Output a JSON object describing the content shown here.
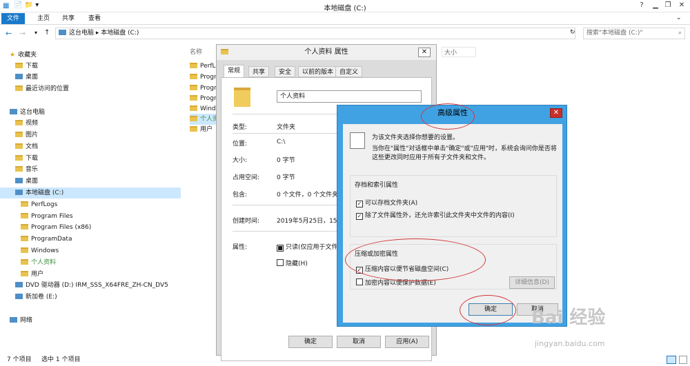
{
  "window": {
    "title": "本地磁盘 (C:)"
  },
  "ribbon": {
    "tabs": [
      "文件",
      "主页",
      "共享",
      "查看"
    ]
  },
  "address": {
    "path": "这台电脑 ▸ 本地磁盘 (C:)",
    "search_placeholder": "搜索\"本地磁盘 (C:)\""
  },
  "nav": {
    "favorites": "收藏夹",
    "fav_items": [
      "下载",
      "桌面",
      "最近访问的位置"
    ],
    "thispc": "这台电脑",
    "pc_items": [
      "视频",
      "图片",
      "文档",
      "下载",
      "音乐",
      "桌面"
    ],
    "drive": "本地磁盘 (C:)",
    "drive_items": [
      "PerfLogs",
      "Program Files",
      "Program Files (x86)",
      "ProgramData",
      "Windows",
      "个人资料",
      "用户"
    ],
    "dvd": "DVD 驱动器 (D:) IRM_SSS_X64FRE_ZH-CN_DV5",
    "newvol": "新加卷 (E:)",
    "network": "网络"
  },
  "main": {
    "col_name": "名称",
    "col_size": "大小",
    "files": [
      "PerfL",
      "Progr",
      "Progr",
      "Progr",
      "Wind",
      "个人资",
      "用户"
    ]
  },
  "status": {
    "count": "7 个项目",
    "selected": "选中 1 个项目"
  },
  "props": {
    "title": "个人资料 属性",
    "tabs": [
      "常规",
      "共享",
      "安全",
      "以前的版本",
      "自定义"
    ],
    "name": "个人资料",
    "rows": [
      {
        "k": "类型:",
        "v": "文件夹"
      },
      {
        "k": "位置:",
        "v": "C:\\"
      },
      {
        "k": "大小:",
        "v": "0 字节"
      },
      {
        "k": "占用空间:",
        "v": "0 字节"
      },
      {
        "k": "包含:",
        "v": "0 个文件，0 个文件夹"
      },
      {
        "k": "创建时间:",
        "v": "2019年5月25日，15:2"
      }
    ],
    "attr_label": "属性:",
    "readonly": "只读(仅应用于文件夹",
    "hidden": "隐藏(H)",
    "ok": "确定",
    "cancel": "取消",
    "apply": "应用(A)"
  },
  "adv": {
    "title": "高级属性",
    "desc1": "为该文件夹选择你想要的设置。",
    "desc2": "当你在\"属性\"对话框中单击\"确定\"或\"应用\"时，系统会询问你是否将这些更改同时应用于所有子文件夹和文件。",
    "grp1": "存档和索引属性",
    "c1": "可以存档文件夹(A)",
    "c2": "除了文件属性外，还允许索引此文件夹中文件的内容(I)",
    "grp2": "压缩或加密属性",
    "c3": "压缩内容以便节省磁盘空间(C)",
    "c4": "加密内容以便保护数据(E)",
    "details": "详细信息(D)",
    "ok": "确定",
    "cancel": "取消"
  },
  "watermark": {
    "logo": "Bai 经验",
    "url": "jingyan.baidu.com"
  }
}
